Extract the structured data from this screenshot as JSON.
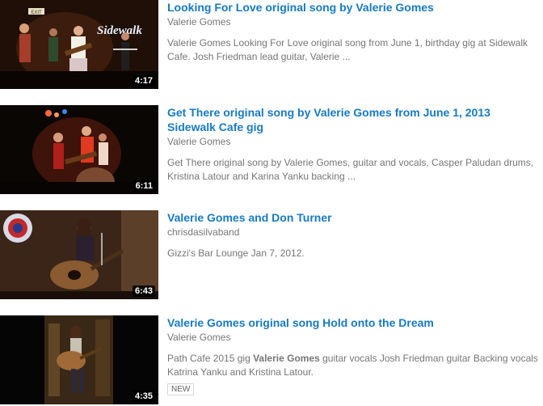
{
  "results": [
    {
      "title": "Looking For Love original song by Valerie Gomes",
      "channel": "Valerie Gomes",
      "description": "Valerie Gomes Looking For Love original song from June 1, birthday gig at Sidewalk Cafe. Josh Friedman lead guitar, Valerie ...",
      "duration": "4:17",
      "thumb_sign_text": "Sidewalk",
      "thumb_exit_text": "EXIT"
    },
    {
      "title": "Get There original song by Valerie Gomes from June 1, 2013 Sidewalk Cafe gig",
      "channel": "Valerie Gomes",
      "description": "Get There original song by Valerie Gomes, guitar and vocals, Casper Paludan drums, Kristina Latour and Karina Yanku backing ...",
      "duration": "6:11"
    },
    {
      "title": "Valerie Gomes and Don Turner",
      "channel": "chrisdasilvaband",
      "description": "Gizzi's Bar Lounge Jan 7, 2012.",
      "duration": "6:43"
    },
    {
      "title": "Valerie Gomes original song Hold onto the Dream",
      "channel": "Valerie Gomes",
      "description_pre": "Path Cafe 2015 gig ",
      "description_bold": "Valerie Gomes",
      "description_post": " guitar vocals Josh Friedman guitar Backing vocals Katrina Yanku and Kristina Latour.",
      "duration": "4:35",
      "badge": "NEW"
    }
  ],
  "colors": {
    "title": "#167ac6",
    "meta": "#767676"
  }
}
